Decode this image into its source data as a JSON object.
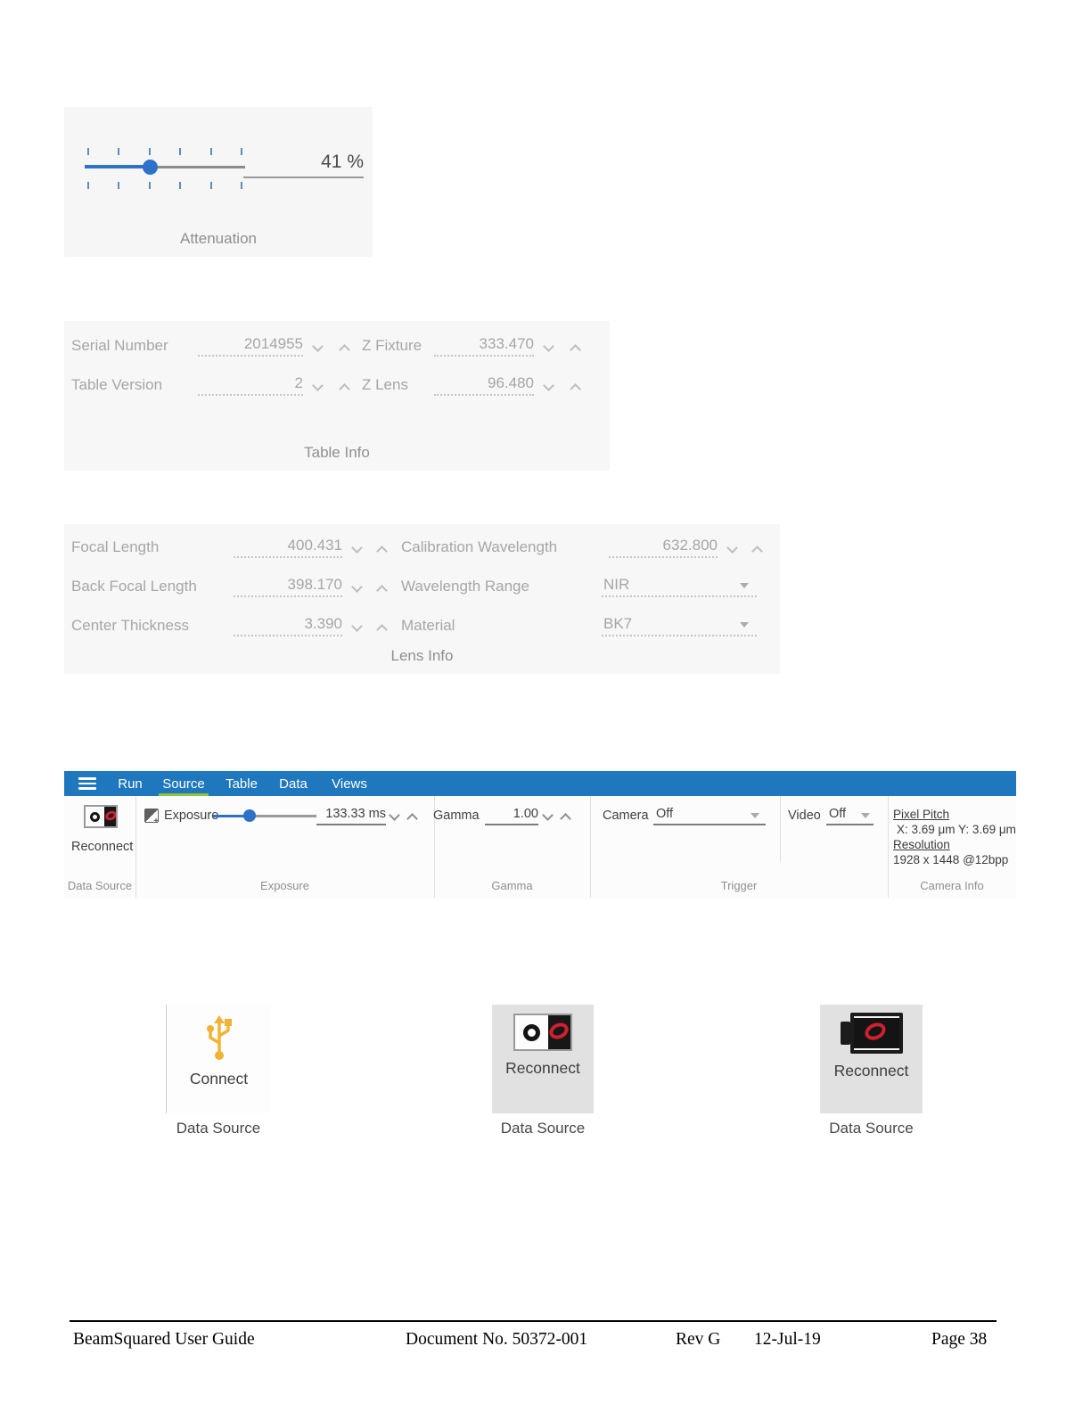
{
  "colors": {
    "ribbon_blue": "#1f77bd",
    "active_tab_green": "#8dc63f",
    "slider_blue": "#2b72c8",
    "usb_yellow": "#f2b234",
    "logo_red": "#cf2030"
  },
  "attenuation": {
    "value": "41 %",
    "label": "Attenuation"
  },
  "table_info": {
    "title": "Table Info",
    "fields": [
      {
        "label": "Serial Number",
        "value": "2014955"
      },
      {
        "label": "Z Fixture",
        "value": "333.470"
      },
      {
        "label": "Table Version",
        "value": "2"
      },
      {
        "label": "Z Lens",
        "value": "96.480"
      }
    ]
  },
  "lens_info": {
    "title": "Lens Info",
    "fields": [
      {
        "label": "Focal Length",
        "value": "400.431"
      },
      {
        "label": "Calibration Wavelength",
        "value": "632.800"
      },
      {
        "label": "Back Focal Length",
        "value": "398.170"
      },
      {
        "label": "Wavelength Range",
        "value": "NIR"
      },
      {
        "label": "Center Thickness",
        "value": "3.390"
      },
      {
        "label": "Material",
        "value": "BK7"
      }
    ]
  },
  "ribbon": {
    "tabs": [
      {
        "label": "Run"
      },
      {
        "label": "Source",
        "active": true
      },
      {
        "label": "Table"
      },
      {
        "label": "Data"
      },
      {
        "label": "Views"
      }
    ],
    "data_source": {
      "button_label": "Reconnect",
      "section_label": "Data Source",
      "icon": "camera-front-icon"
    },
    "exposure": {
      "label": "Exposure",
      "value": "133.33 ms",
      "section_label": "Exposure",
      "icon": "auto-exposure-icon"
    },
    "gamma": {
      "label": "Gamma",
      "value": "1.00",
      "section_label": "Gamma"
    },
    "trigger": {
      "camera_label": "Camera",
      "camera_value": "Off",
      "video_label": "Video",
      "video_value": "Off",
      "section_label": "Trigger"
    },
    "camera_info": {
      "pixel_pitch_label": "Pixel Pitch",
      "pixel_pitch_value": "X: 3.69 μm Y: 3.69 μm",
      "resolution_label": "Resolution",
      "resolution_value": "1928 x 1448 @12bpp",
      "section_label": "Camera Info"
    }
  },
  "demo_buttons": [
    {
      "label": "Connect",
      "section_label": "Data Source",
      "icon": "usb-icon"
    },
    {
      "label": "Reconnect",
      "section_label": "Data Source",
      "icon": "camera-front-icon"
    },
    {
      "label": "Reconnect",
      "section_label": "Data Source",
      "icon": "camera-side-icon"
    }
  ],
  "footer": {
    "title": "BeamSquared User Guide",
    "document_no": "Document No. 50372-001",
    "rev": "Rev G",
    "date": "12-Jul-19",
    "page": "Page 38"
  }
}
